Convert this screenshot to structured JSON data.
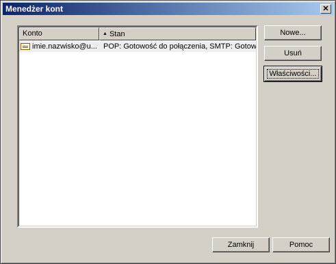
{
  "window": {
    "title": "Menedżer kont"
  },
  "list": {
    "columns": {
      "konto": "Konto",
      "stan": "Stan"
    },
    "rows": [
      {
        "konto": "imie.nazwisko@u...",
        "stan": "POP: Gotowość do połączenia, SMTP: Gotow..."
      }
    ]
  },
  "buttons": {
    "nowe": "Nowe...",
    "usun": "Usuń",
    "wlasciwosci": "Właściwości...",
    "zamknij": "Zamknij",
    "pomoc": "Pomoc"
  }
}
